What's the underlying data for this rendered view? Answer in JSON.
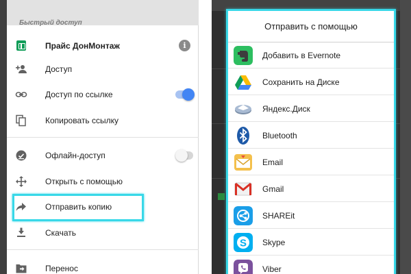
{
  "left_panel": {
    "quick_access_title": "Быстрый доступ",
    "document": {
      "title": "Прайс ДонМонтаж",
      "icon": "sheets-icon",
      "info_icon": "i"
    },
    "menu_items": [
      {
        "label": "Доступ",
        "icon": "person-add-icon"
      },
      {
        "label": "Доступ по ссылке",
        "icon": "link-icon",
        "toggle": "on"
      },
      {
        "label": "Копировать ссылку",
        "icon": "copy-icon"
      },
      {
        "label": "Офлайн-доступ",
        "icon": "offline-check-icon",
        "toggle": "off"
      },
      {
        "label": "Открыть с помощью",
        "icon": "move-arrows-icon"
      },
      {
        "label": "Отправить копию",
        "icon": "share-arrow-icon",
        "highlighted": true
      },
      {
        "label": "Скачать",
        "icon": "download-icon"
      },
      {
        "label": "Перенос",
        "icon": "folder-move-icon"
      }
    ]
  },
  "share_dialog": {
    "title": "Отправить с помощью",
    "apps": [
      {
        "label": "Добавить в Evernote",
        "icon": "evernote-icon"
      },
      {
        "label": "Сохранить на Диске",
        "icon": "google-drive-icon"
      },
      {
        "label": "Яндекс.Диск",
        "icon": "yandex-disk-icon"
      },
      {
        "label": "Bluetooth",
        "icon": "bluetooth-icon"
      },
      {
        "label": "Email",
        "icon": "email-icon"
      },
      {
        "label": "Gmail",
        "icon": "gmail-icon"
      },
      {
        "label": "SHAREit",
        "icon": "shareit-icon"
      },
      {
        "label": "Skype",
        "icon": "skype-icon"
      },
      {
        "label": "Viber",
        "icon": "viber-icon"
      }
    ]
  },
  "colors": {
    "highlight": "#38d8e8",
    "toggle_on": "#4285f4",
    "sheets_green": "#0f9d58"
  }
}
